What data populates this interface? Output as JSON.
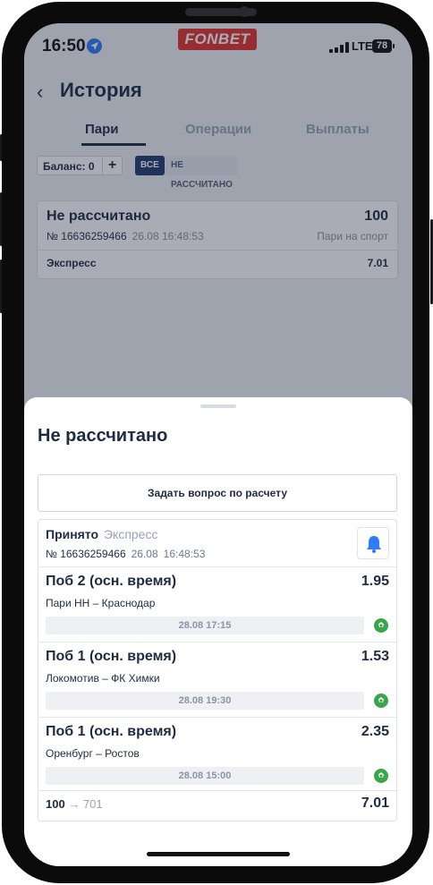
{
  "status_bar": {
    "time": "16:50",
    "network": "LTE",
    "battery": "78"
  },
  "brand": {
    "logo_text": "FONBET",
    "color": "#e4322b"
  },
  "header": {
    "back_icon": "chevron-left-icon",
    "title": "История"
  },
  "tabs": [
    {
      "label": "Пари",
      "active": true
    },
    {
      "label": "Операции",
      "active": false
    },
    {
      "label": "Выплаты",
      "active": false
    }
  ],
  "filters": {
    "balance_label": "Баланс: 0",
    "plus_label": "+",
    "all_label": "ВСЕ",
    "not_settled_label": "НЕ РАССЧИТАНО"
  },
  "bet_list": [
    {
      "status": "Не рассчитано",
      "amount": "100",
      "number": "№ 16636259466",
      "datetime": "26.08 16:48:53",
      "kind": "Пари на спорт",
      "type": "Экспресс",
      "coef": "7.01"
    }
  ],
  "sheet": {
    "title": "Не рассчитано",
    "ask_button": "Задать вопрос по расчету",
    "accepted": "Принято",
    "bet_type": "Экспресс",
    "number": "№ 16636259466",
    "date": "26.08",
    "time": "16:48:53",
    "events": [
      {
        "outcome": "Поб 2 (осн. время)",
        "odd": "1.95",
        "teams": "Пари НН – Краснодар",
        "start": "28.08 17:15"
      },
      {
        "outcome": "Поб 1 (осн. время)",
        "odd": "1.53",
        "teams": "Локомотив – ФК Химки",
        "start": "28.08 19:30"
      },
      {
        "outcome": "Поб 1 (осн. время)",
        "odd": "2.35",
        "teams": "Оренбург – Ростов",
        "start": "28.08 15:00"
      }
    ],
    "stake": "100",
    "arrow": "→",
    "potential_win": "701",
    "total_coef": "7.01"
  },
  "colors": {
    "accent": "#1f3a6e",
    "text": "#1f2a44",
    "muted": "#9aa2b4",
    "bell": "#2f7cf6",
    "ball": "#3aa64a"
  }
}
